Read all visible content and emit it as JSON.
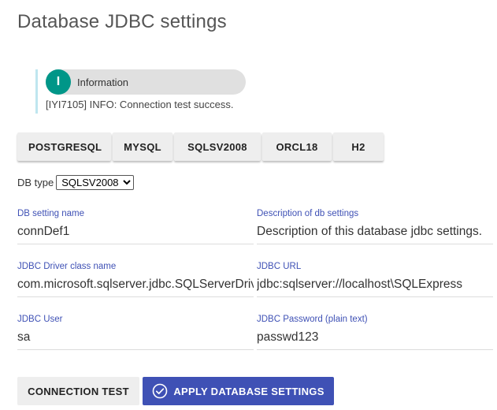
{
  "page": {
    "title": "Database JDBC settings"
  },
  "info": {
    "icon_letter": "I",
    "label": "Information",
    "message": "[IYI7105] INFO: Connection test success.",
    "accent_color": "#009688"
  },
  "db_buttons": [
    "POSTGRESQL",
    "MYSQL",
    "SQLSV2008",
    "ORCL18",
    "H2"
  ],
  "db_type": {
    "label": "DB type",
    "selected": "SQLSV2008",
    "options": [
      "SQLSV2008"
    ]
  },
  "fields": {
    "setting_name": {
      "label": "DB setting name",
      "value": "connDef1"
    },
    "description": {
      "label": "Description of db settings",
      "value": "Description of this database jdbc settings."
    },
    "driver_class": {
      "label": "JDBC Driver class name",
      "value": "com.microsoft.sqlserver.jdbc.SQLServerDriver"
    },
    "jdbc_url": {
      "label": "JDBC URL",
      "value": "jdbc:sqlserver://localhost\\SQLExpress"
    },
    "jdbc_user": {
      "label": "JDBC User",
      "value": "sa"
    },
    "jdbc_password": {
      "label": "JDBC Password (plain text)",
      "value": "passwd123"
    }
  },
  "actions": {
    "connection_test": "CONNECTION TEST",
    "apply": "APPLY DATABASE SETTINGS",
    "apply_icon": "check-circle-icon",
    "primary_color": "#3f51b5"
  }
}
